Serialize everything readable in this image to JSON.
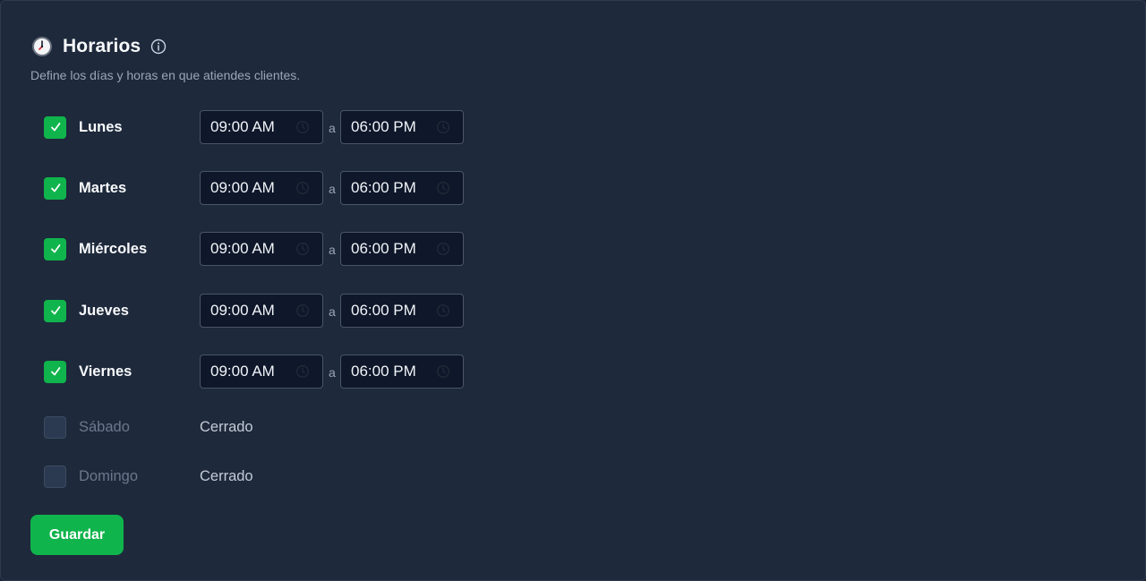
{
  "header": {
    "title": "Horarios",
    "subtitle": "Define los días y horas en que atiendes clientes."
  },
  "separator": "a",
  "days": [
    {
      "name": "Lunes",
      "enabled": true,
      "from": "09:00 AM",
      "to": "06:00 PM"
    },
    {
      "name": "Martes",
      "enabled": true,
      "from": "09:00 AM",
      "to": "06:00 PM"
    },
    {
      "name": "Miércoles",
      "enabled": true,
      "from": "09:00 AM",
      "to": "06:00 PM"
    },
    {
      "name": "Jueves",
      "enabled": true,
      "from": "09:00 AM",
      "to": "06:00 PM"
    },
    {
      "name": "Viernes",
      "enabled": true,
      "from": "09:00 AM",
      "to": "06:00 PM"
    },
    {
      "name": "Sábado",
      "enabled": false,
      "closed_label": "Cerrado"
    },
    {
      "name": "Domingo",
      "enabled": false,
      "closed_label": "Cerrado"
    }
  ],
  "actions": {
    "save_label": "Guardar"
  },
  "icons": {
    "header_icon": "clock-emoji-icon",
    "info": "info-icon",
    "checkbox_checked": "checkmark-icon",
    "time_field": "clock-icon"
  },
  "colors": {
    "accent": "#10b44c",
    "panel": "#1e293b",
    "input_bg": "#0f172a"
  }
}
